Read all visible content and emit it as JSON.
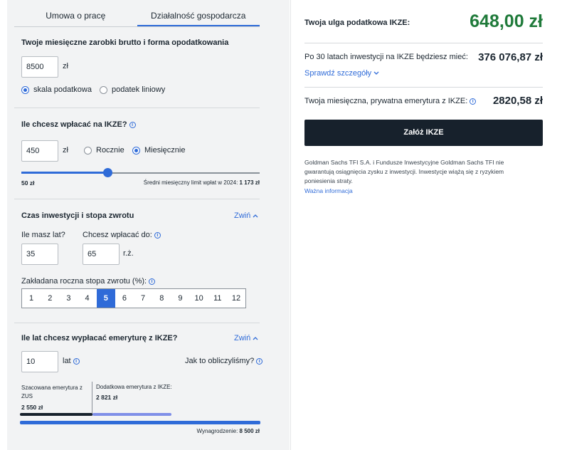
{
  "tabs": [
    {
      "label": "Umowa o pracę",
      "active": false
    },
    {
      "label": "Działalność gospodarcza",
      "active": true
    }
  ],
  "earnings": {
    "title": "Twoje miesięczne zarobki brutto i forma opodatkowania",
    "value": "8500",
    "unit": "zł",
    "tax_options": [
      {
        "label": "skala podatkowa",
        "selected": true
      },
      {
        "label": "podatek liniowy",
        "selected": false
      }
    ]
  },
  "contribution": {
    "title": "Ile chcesz wpłacać na IKZE?",
    "value": "450",
    "unit": "zł",
    "frequency": [
      {
        "label": "Rocznie",
        "selected": false
      },
      {
        "label": "Miesięcznie",
        "selected": true
      }
    ],
    "slider_min_label": "50 zł",
    "slider_fraction": 0.36,
    "limit_label": "Średni miesięczny limit wpłat w 2024:",
    "limit_value": "1 173 zł"
  },
  "investment": {
    "title": "Czas inwestycji i stopa zwrotu",
    "collapse_label": "Zwiń",
    "age_label": "Ile masz lat?",
    "age_value": "35",
    "until_label": "Chcesz wpłacać do:",
    "until_value": "65",
    "until_unit": "r.ż.",
    "rate_label": "Zakładana roczna stopa zwrotu (%):",
    "rates": [
      "1",
      "2",
      "3",
      "4",
      "5",
      "6",
      "7",
      "8",
      "9",
      "10",
      "11",
      "12"
    ],
    "selected_rate": "5"
  },
  "payout": {
    "title": "Ile lat chcesz wypłacać emeryturę z IKZE?",
    "collapse_label": "Zwiń",
    "years_value": "10",
    "years_unit": "lat",
    "how_label": "Jak to obliczyliśmy?",
    "zus_label": "Szacowana emerytura z ZUS",
    "zus_value": "2 550 zł",
    "ikze_label": "Dodatkowa emerytura z IKZE:",
    "ikze_value": "2 821 zł",
    "salary_label": "Wynagrodzenie:",
    "salary_value": "8 500 zł"
  },
  "summary": {
    "relief_label": "Twoja ulga podatkowa IKZE:",
    "relief_value": "648,00 zł",
    "after_label": "Po 30 latach inwestycji na IKZE będziesz mieć:",
    "after_value": "376 076,87 zł",
    "details_link": "Sprawdź szczegóły",
    "pension_label": "Twoja miesięczna, prywatna emerytura z IKZE:",
    "pension_value": "2820,58 zł",
    "cta_label": "Załóż IKZE",
    "disclaimer": "Goldman Sachs TFI S.A. i Fundusze Inwestycyjne Goldman Sachs TFI nie gwarantują osiągnięcia zysku z inwestycji. Inwestycje wiążą się z ryzykiem poniesienia straty.",
    "info_link": "Ważna informacja"
  },
  "colors": {
    "accent": "#2f6bd8",
    "relief_green": "#1f7a3a",
    "cta_dark": "#17212c",
    "zus_bar": "#17212c",
    "ikze_bar": "#7f8fe8"
  },
  "icons": {
    "info": "info-circle-icon",
    "chevron_up": "chevron-up-icon",
    "chevron_down": "chevron-down-icon"
  }
}
